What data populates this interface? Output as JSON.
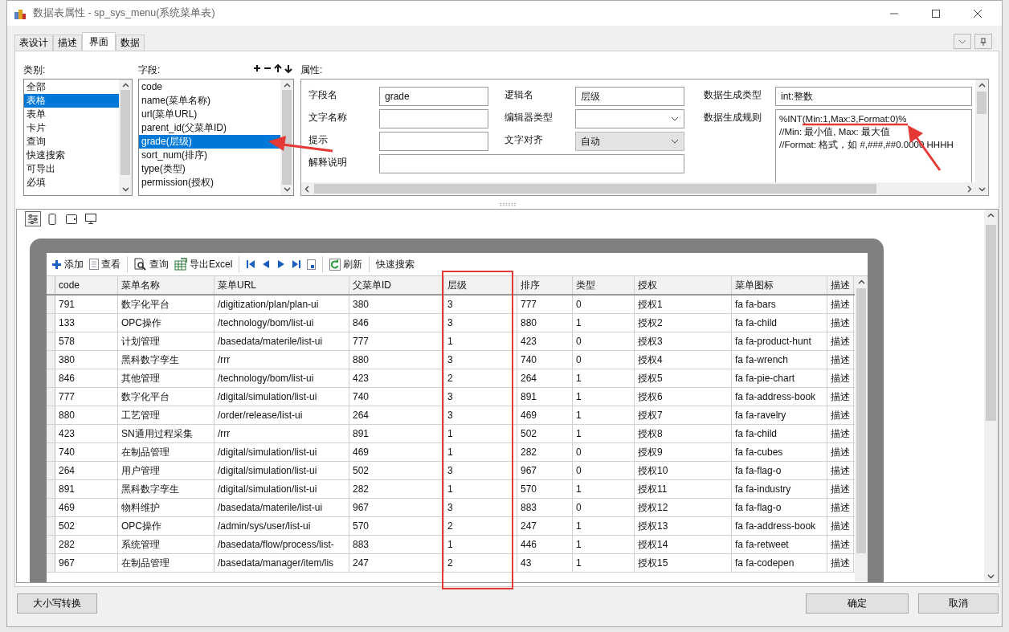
{
  "window": {
    "title": "数据表属性 - sp_sys_menu(系统菜单表)"
  },
  "tabs": [
    {
      "label": "表设计",
      "selected": false
    },
    {
      "label": "描述",
      "selected": false
    },
    {
      "label": "界面",
      "selected": true
    },
    {
      "label": "数据",
      "selected": false
    }
  ],
  "categories": {
    "label": "类别:",
    "items": [
      {
        "label": "全部",
        "selected": false
      },
      {
        "label": "表格",
        "selected": true
      },
      {
        "label": "表单",
        "selected": false
      },
      {
        "label": "卡片",
        "selected": false
      },
      {
        "label": "查询",
        "selected": false
      },
      {
        "label": "快速搜索",
        "selected": false
      },
      {
        "label": "可导出",
        "selected": false
      },
      {
        "label": "必填",
        "selected": false
      }
    ]
  },
  "fields": {
    "label": "字段:",
    "items": [
      {
        "label": "code",
        "selected": false
      },
      {
        "label": "name(菜单名称)",
        "selected": false
      },
      {
        "label": "url(菜单URL)",
        "selected": false
      },
      {
        "label": "parent_id(父菜单ID)",
        "selected": false
      },
      {
        "label": "grade(层级)",
        "selected": true
      },
      {
        "label": "sort_num(排序)",
        "selected": false
      },
      {
        "label": "type(类型)",
        "selected": false
      },
      {
        "label": "permission(授权)",
        "selected": false
      }
    ]
  },
  "properties": {
    "label": "属性:",
    "items": [
      {
        "label": "字段名",
        "kind": "text",
        "value": "grade"
      },
      {
        "label": "逻辑名",
        "kind": "text",
        "value": "层级"
      },
      {
        "label": "文字名称",
        "kind": "text"
      },
      {
        "label": "编辑器类型",
        "kind": "select",
        "disabled": false
      },
      {
        "label": "提示",
        "kind": "text"
      },
      {
        "label": "文字对齐",
        "kind": "select",
        "value": "自动",
        "disabled": true
      },
      {
        "label": "解释说明",
        "kind": "wide"
      }
    ],
    "gen_type": {
      "label": "数据生成类型",
      "value": "int:整数"
    },
    "gen_rule": {
      "label": "数据生成规则",
      "lines": [
        "%INT(Min:1,Max:3,Format:0)%",
        "//Min: 最小值, Max: 最大值",
        "//Format: 格式，如 #,###,##0.0000 HHHH"
      ]
    }
  },
  "grid": {
    "toolbar": [
      {
        "kind": "add",
        "label": "添加"
      },
      {
        "kind": "view",
        "label": "查看"
      },
      {
        "kind": "separator"
      },
      {
        "kind": "query",
        "label": "查询"
      },
      {
        "kind": "export",
        "label": "导出Excel"
      },
      {
        "kind": "separator"
      },
      {
        "kind": "first"
      },
      {
        "kind": "prev"
      },
      {
        "kind": "next"
      },
      {
        "kind": "last"
      },
      {
        "kind": "page"
      },
      {
        "kind": "separator"
      },
      {
        "kind": "refresh",
        "label": "刷新"
      },
      {
        "kind": "separator"
      },
      {
        "kind": "search",
        "label": "快速搜索"
      }
    ],
    "columns": [
      "code",
      "菜单名称",
      "菜单URL",
      "父菜单ID",
      "层级",
      "排序",
      "类型",
      "授权",
      "菜单图标",
      "描述"
    ],
    "rows": [
      [
        "791",
        "数字化平台",
        "/digitization/plan/plan-ui",
        "380",
        "3",
        "777",
        "0",
        "授权1",
        "fa fa-bars",
        "描述"
      ],
      [
        "133",
        "OPC操作",
        "/technology/bom/list-ui",
        "846",
        "3",
        "880",
        "1",
        "授权2",
        "fa fa-child",
        "描述"
      ],
      [
        "578",
        "计划管理",
        "/basedata/materile/list-ui",
        "777",
        "1",
        "423",
        "0",
        "授权3",
        "fa fa-product-hunt",
        "描述"
      ],
      [
        "380",
        "黑科数字孪生",
        "/rrr",
        "880",
        "3",
        "740",
        "0",
        "授权4",
        "fa fa-wrench",
        "描述"
      ],
      [
        "846",
        "其他管理",
        "/technology/bom/list-ui",
        "423",
        "2",
        "264",
        "1",
        "授权5",
        "fa fa-pie-chart",
        "描述"
      ],
      [
        "777",
        "数字化平台",
        "/digital/simulation/list-ui",
        "740",
        "3",
        "891",
        "1",
        "授权6",
        "fa fa-address-book",
        "描述"
      ],
      [
        "880",
        "工艺管理",
        "/order/release/list-ui",
        "264",
        "3",
        "469",
        "1",
        "授权7",
        "fa fa-ravelry",
        "描述"
      ],
      [
        "423",
        "SN通用过程采集",
        "/rrr",
        "891",
        "1",
        "502",
        "1",
        "授权8",
        "fa fa-child",
        "描述"
      ],
      [
        "740",
        "在制品管理",
        "/digital/simulation/list-ui",
        "469",
        "1",
        "282",
        "0",
        "授权9",
        "fa fa-cubes",
        "描述"
      ],
      [
        "264",
        "用户管理",
        "/digital/simulation/list-ui",
        "502",
        "3",
        "967",
        "0",
        "授权10",
        "fa fa-flag-o",
        "描述"
      ],
      [
        "891",
        "黑科数字孪生",
        "/digital/simulation/list-ui",
        "282",
        "1",
        "570",
        "1",
        "授权11",
        "fa fa-industry",
        "描述"
      ],
      [
        "469",
        "物料维护",
        "/basedata/materile/list-ui",
        "967",
        "3",
        "883",
        "0",
        "授权12",
        "fa fa-flag-o",
        "描述"
      ],
      [
        "502",
        "OPC操作",
        "/admin/sys/user/list-ui",
        "570",
        "2",
        "247",
        "1",
        "授权13",
        "fa fa-address-book",
        "描述"
      ],
      [
        "282",
        "系统管理",
        "/basedata/flow/process/list-",
        "883",
        "1",
        "446",
        "1",
        "授权14",
        "fa fa-retweet",
        "描述"
      ],
      [
        "967",
        "在制品管理",
        "/basedata/manager/item/lis",
        "247",
        "2",
        "43",
        "1",
        "授权15",
        "fa fa-codepen",
        "描述"
      ]
    ]
  },
  "buttons": [
    {
      "kind": "case",
      "label": "大小写转换"
    },
    {
      "kind": "ok",
      "label": "确定"
    },
    {
      "kind": "cancel",
      "label": "取消"
    }
  ]
}
